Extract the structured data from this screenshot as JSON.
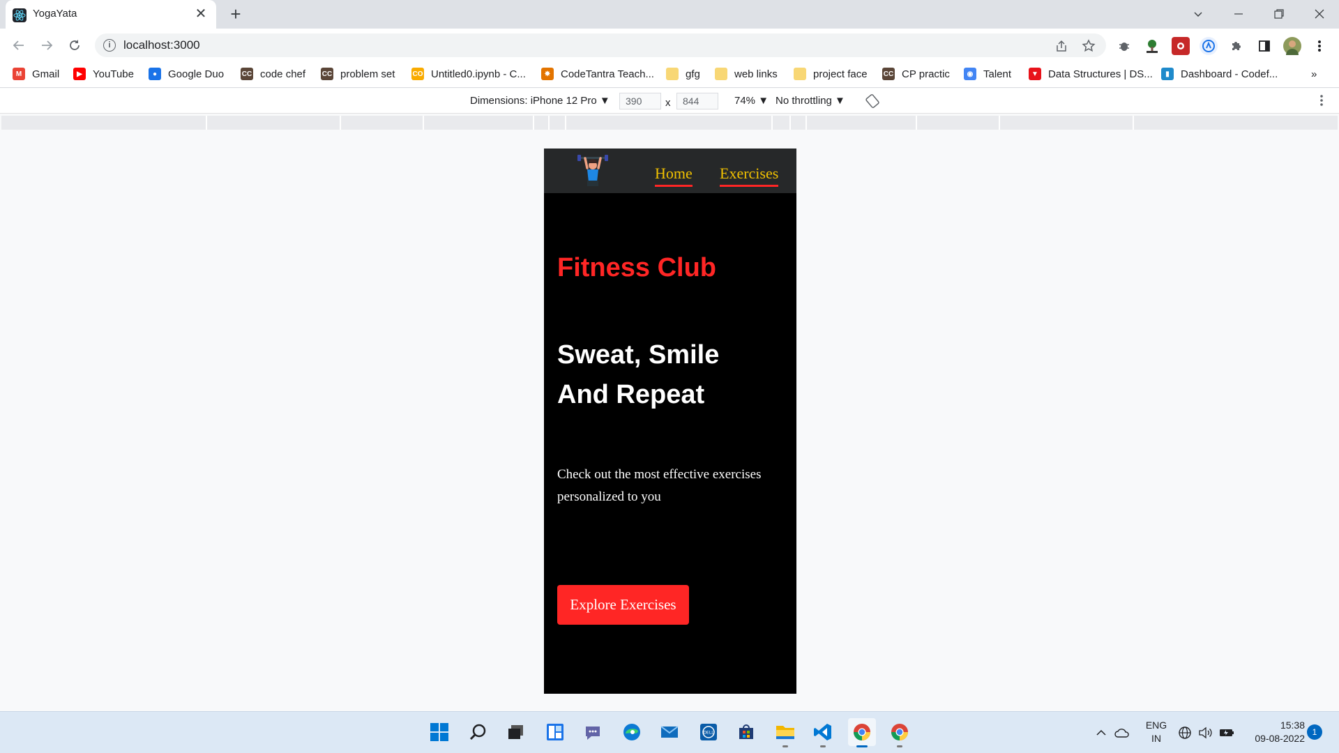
{
  "browser": {
    "tab": {
      "title": "YogaYata",
      "favicon": "react-icon"
    },
    "url": "localhost:3000",
    "window_controls": [
      "chevron-down-icon",
      "minimize-icon",
      "restore-icon",
      "close-icon"
    ],
    "bookmarks": [
      {
        "label": "Gmail",
        "icon": "gmail-icon",
        "color": "#ea4335"
      },
      {
        "label": "YouTube",
        "icon": "youtube-icon",
        "color": "#ff0000"
      },
      {
        "label": "Google Duo",
        "icon": "duo-icon",
        "color": "#1a73e8"
      },
      {
        "label": "code chef",
        "icon": "codechef-icon",
        "color": "#5b4638"
      },
      {
        "label": "problem set",
        "icon": "codechef-icon",
        "color": "#5b4638"
      },
      {
        "label": "Untitled0.ipynb - C...",
        "icon": "colab-icon",
        "color": "#f9ab00"
      },
      {
        "label": "CodeTantra Teach...",
        "icon": "codetantra-icon",
        "color": "#e37400"
      },
      {
        "label": "gfg",
        "icon": "folder-icon",
        "color": "#f8d775"
      },
      {
        "label": "web links",
        "icon": "folder-icon",
        "color": "#f8d775"
      },
      {
        "label": "project face",
        "icon": "folder-icon",
        "color": "#f8d775"
      },
      {
        "label": "CP practic",
        "icon": "codechef-icon",
        "color": "#5b4638"
      },
      {
        "label": "Talent",
        "icon": "talent-icon",
        "color": "#4285f4"
      },
      {
        "label": "Data Structures | DS...",
        "icon": "tutorialcup-icon",
        "color": "#e8131b"
      },
      {
        "label": "Dashboard - Codef...",
        "icon": "codeforces-icon",
        "color": "#1f8acb"
      }
    ],
    "bookmarks_more": "»"
  },
  "devtools": {
    "dimensions_label": "Dimensions: iPhone 12 Pro ▼",
    "width": "390",
    "times": "x",
    "height": "844",
    "zoom": "74% ▼",
    "throttling": "No throttling ▼"
  },
  "app": {
    "nav": {
      "home": "Home",
      "exercises": "Exercises"
    },
    "brand_tagline": "Fitness Club",
    "headline_line1": "Sweat, Smile",
    "headline_line2": "And Repeat",
    "subtext": "Check out the most effective exercises personalized to you",
    "cta": "Explore Exercises",
    "colors": {
      "accent": "#ff2625",
      "nav_link": "#f2c200",
      "nav_bg": "#262829",
      "page_bg": "#000000"
    }
  },
  "taskbar": {
    "apps": [
      "windows-start-icon",
      "search-icon",
      "task-view-icon",
      "widgets-icon",
      "teams-chat-icon",
      "edge-icon",
      "mail-icon",
      "dell-icon",
      "store-icon",
      "file-explorer-icon",
      "vscode-icon",
      "chrome-icon",
      "chrome-icon"
    ],
    "lang_line1": "ENG",
    "lang_line2": "IN",
    "time": "15:38",
    "date": "09-08-2022",
    "notifications": "1"
  }
}
